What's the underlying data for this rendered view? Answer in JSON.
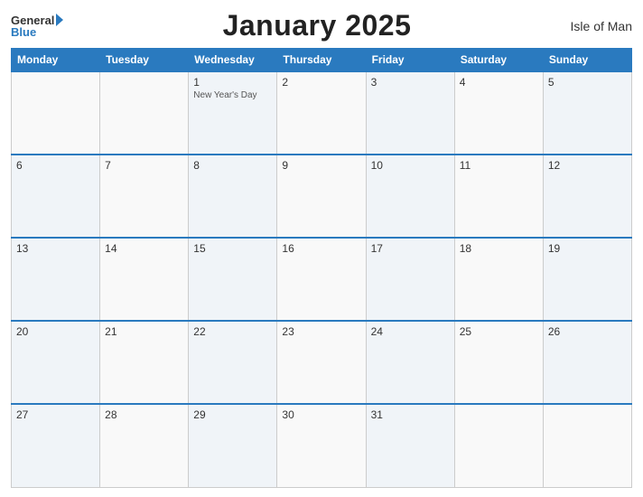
{
  "header": {
    "logo_general": "General",
    "logo_blue": "Blue",
    "title": "January 2025",
    "region": "Isle of Man"
  },
  "days_of_week": [
    "Monday",
    "Tuesday",
    "Wednesday",
    "Thursday",
    "Friday",
    "Saturday",
    "Sunday"
  ],
  "weeks": [
    [
      {
        "num": "",
        "empty": true
      },
      {
        "num": "",
        "empty": true
      },
      {
        "num": "1",
        "holiday": "New Year's Day"
      },
      {
        "num": "2"
      },
      {
        "num": "3"
      },
      {
        "num": "4"
      },
      {
        "num": "5"
      }
    ],
    [
      {
        "num": "6"
      },
      {
        "num": "7"
      },
      {
        "num": "8"
      },
      {
        "num": "9"
      },
      {
        "num": "10"
      },
      {
        "num": "11"
      },
      {
        "num": "12"
      }
    ],
    [
      {
        "num": "13"
      },
      {
        "num": "14"
      },
      {
        "num": "15"
      },
      {
        "num": "16"
      },
      {
        "num": "17"
      },
      {
        "num": "18"
      },
      {
        "num": "19"
      }
    ],
    [
      {
        "num": "20"
      },
      {
        "num": "21"
      },
      {
        "num": "22"
      },
      {
        "num": "23"
      },
      {
        "num": "24"
      },
      {
        "num": "25"
      },
      {
        "num": "26"
      }
    ],
    [
      {
        "num": "27"
      },
      {
        "num": "28"
      },
      {
        "num": "29"
      },
      {
        "num": "30"
      },
      {
        "num": "31"
      },
      {
        "num": "",
        "empty": true
      },
      {
        "num": "",
        "empty": true
      }
    ]
  ]
}
